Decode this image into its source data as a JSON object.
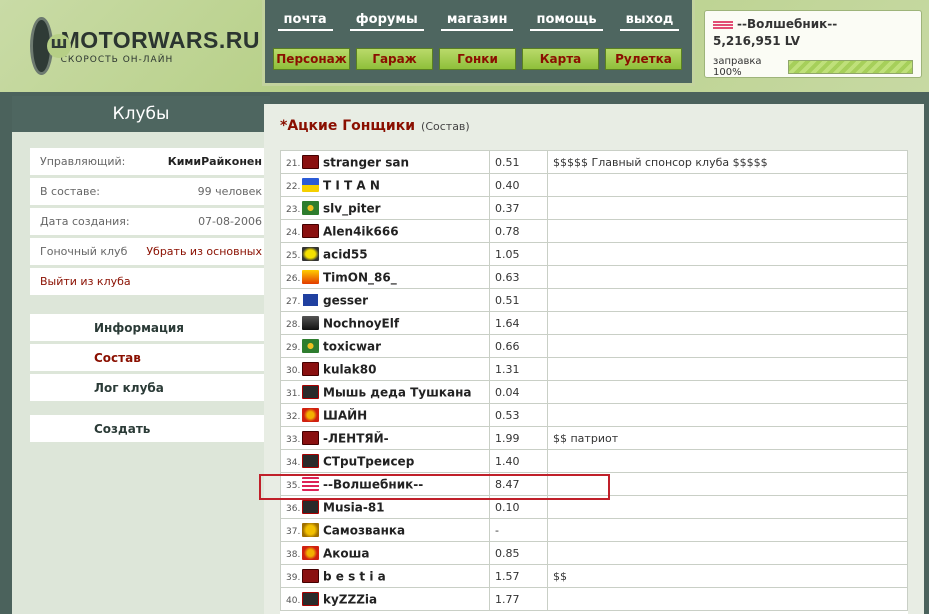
{
  "header": {
    "logo_title": "MOTORWARS.RU",
    "logo_subtitle": "СКОРОСТЬ ОН-ЛАЙН",
    "nav_top": [
      "почта",
      "форумы",
      "магазин",
      "помощь",
      "выход"
    ],
    "nav_bottom": [
      "Персонаж",
      "Гараж",
      "Гонки",
      "Карта",
      "Рулетка"
    ],
    "user": {
      "name": "--Волшебник--",
      "lv": "5,216,951 LV",
      "fuel_label": "заправка 100%",
      "fuel_percent": 100
    }
  },
  "left": {
    "title": "Клубы",
    "info": [
      {
        "label": "Управляющий:",
        "value": "КимиРайконен"
      },
      {
        "label": "В составе:",
        "value": "99 человек"
      },
      {
        "label": "Дата создания:",
        "value": "07-08-2006"
      },
      {
        "label": "Гоночный клуб",
        "value": "Убрать из основных"
      }
    ],
    "leave": "Выйти из клуба",
    "menu": [
      "Информация",
      "Состав",
      "Лог клуба"
    ],
    "create": "Создать"
  },
  "main": {
    "club_name": "*Ацкие Гонщики",
    "club_sub": "(Состав)",
    "rows": [
      {
        "n": "21.",
        "name": "stranger san",
        "score": "0.51",
        "note": "$$$$$ Главный спонсор клуба $$$$$",
        "icon": "d-badge-icon"
      },
      {
        "n": "22.",
        "name": "T I T A N",
        "score": "0.40",
        "note": "",
        "icon": "ukraine-flag-icon"
      },
      {
        "n": "23.",
        "name": "slv_piter",
        "score": "0.37",
        "note": "",
        "icon": "green-emblem-icon"
      },
      {
        "n": "24.",
        "name": "Alen4ik666",
        "score": "0.78",
        "note": "",
        "icon": "d-badge-icon"
      },
      {
        "n": "25.",
        "name": "acid55",
        "score": "1.05",
        "note": "",
        "icon": "yellow-disc-icon"
      },
      {
        "n": "26.",
        "name": "TimON_86_",
        "score": "0.63",
        "note": "",
        "icon": "flame-icon"
      },
      {
        "n": "27.",
        "name": "gesser",
        "score": "0.51",
        "note": "",
        "icon": "cv-logo-icon"
      },
      {
        "n": "28.",
        "name": "NochnoyElf",
        "score": "1.64",
        "note": "",
        "icon": "dark-figure-icon"
      },
      {
        "n": "29.",
        "name": "toxicwar",
        "score": "0.66",
        "note": "",
        "icon": "green-emblem-icon"
      },
      {
        "n": "30.",
        "name": "kulak80",
        "score": "1.31",
        "note": "",
        "icon": "d-badge-icon"
      },
      {
        "n": "31.",
        "name": "Мышь деда Тушкана",
        "score": "0.04",
        "note": "",
        "icon": "skull-flag-icon"
      },
      {
        "n": "32.",
        "name": "ШАЙН",
        "score": "0.53",
        "note": "",
        "icon": "red-star-icon"
      },
      {
        "n": "33.",
        "name": "-ЛЕНТЯЙ-",
        "score": "1.99",
        "note": "$$ патриот",
        "icon": "d-badge-icon"
      },
      {
        "n": "34.",
        "name": "СТрuТреисер",
        "score": "1.40",
        "note": "",
        "icon": "skull-flag-icon"
      },
      {
        "n": "35.",
        "name": "--Волшебник--",
        "score": "8.47",
        "note": "",
        "icon": "car-stripes-icon"
      },
      {
        "n": "36.",
        "name": "Musia-81",
        "score": "0.10",
        "note": "",
        "icon": "skull-flag-icon"
      },
      {
        "n": "37.",
        "name": "Самозванка",
        "score": "-",
        "note": "",
        "icon": "crown-icon"
      },
      {
        "n": "38.",
        "name": "Акоша",
        "score": "0.85",
        "note": "",
        "icon": "red-star-icon"
      },
      {
        "n": "39.",
        "name": "b e s t i a",
        "score": "1.57",
        "note": "$$",
        "icon": "d-badge-icon"
      },
      {
        "n": "40.",
        "name": "kyZZZia",
        "score": "1.77",
        "note": "",
        "icon": "skull-flag-icon"
      }
    ]
  },
  "colors": {
    "accent_red": "#8a0f00",
    "dark_green": "#4e6660",
    "button_green": "#9fcb4f",
    "highlight": "#c0202a"
  }
}
